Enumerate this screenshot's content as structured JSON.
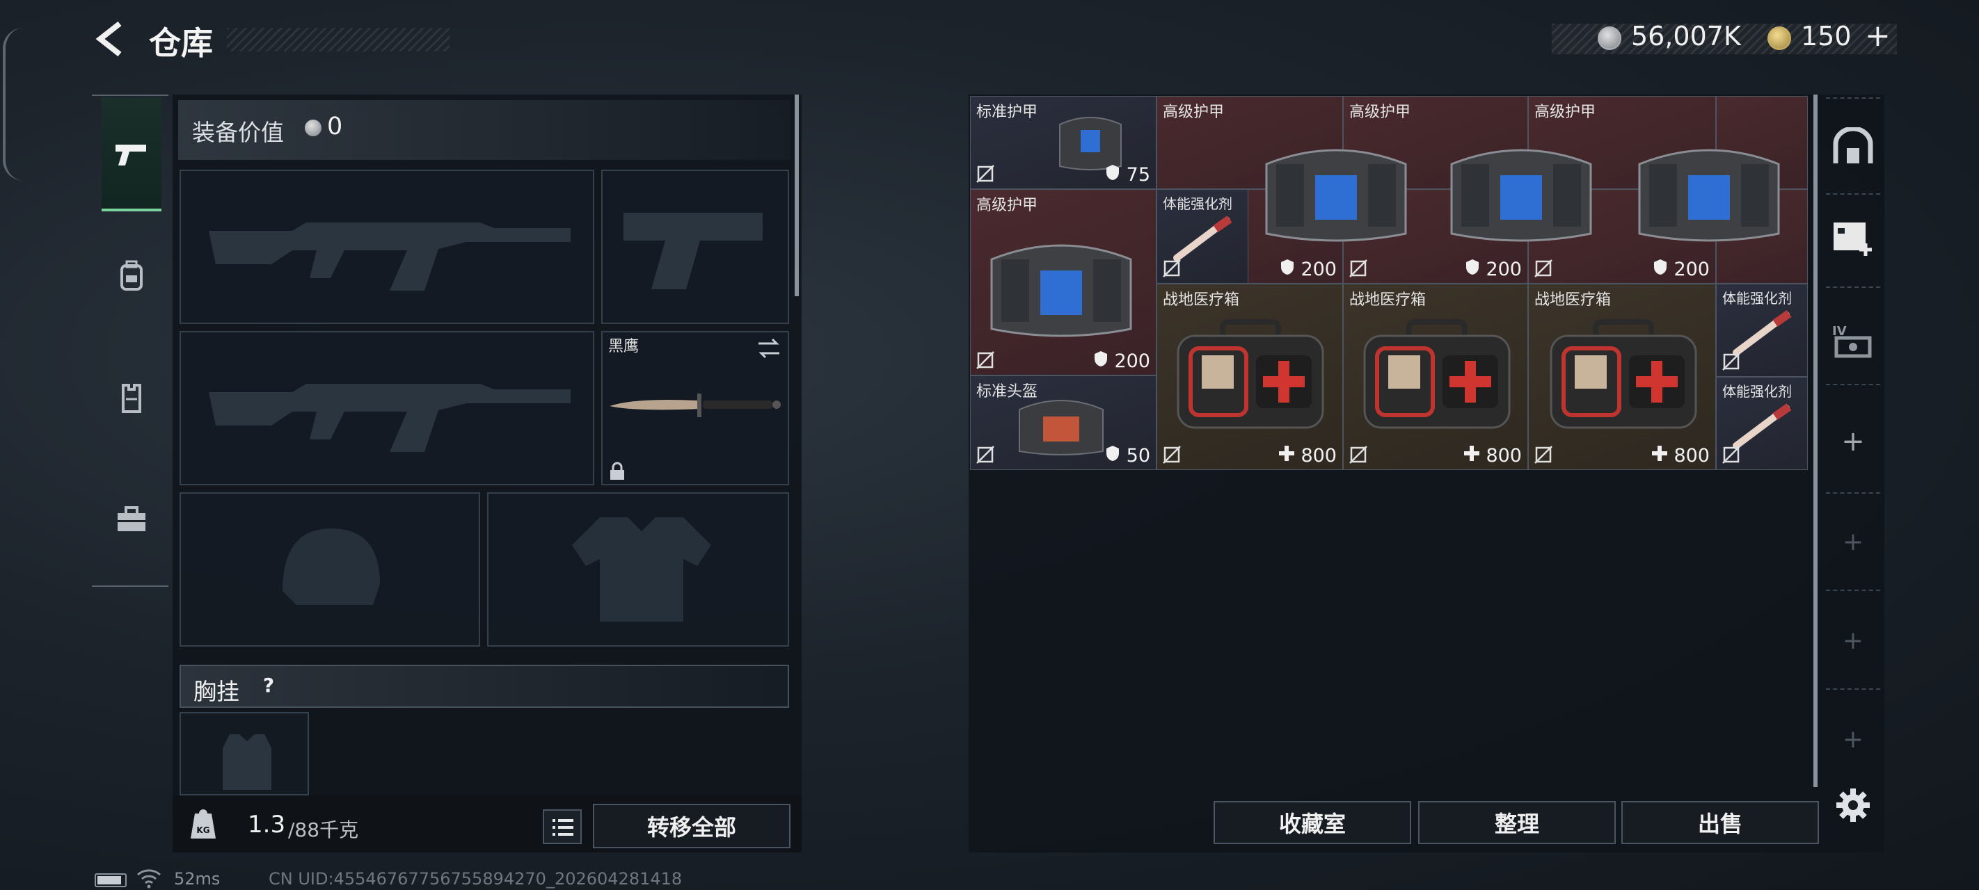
{
  "header": {
    "title": "仓库",
    "silver_amount": "56,007K",
    "gold_amount": "150"
  },
  "left": {
    "equip_value_label": "装备价值",
    "equip_value": "0",
    "melee": {
      "name": "黑鹰"
    },
    "chest_rig_label": "胸挂",
    "chest_rig_help": "?",
    "weight": {
      "current": "1.3",
      "max": "/88千克"
    },
    "transfer_all": "转移全部"
  },
  "grid": {
    "items": [
      {
        "name": "标准护甲",
        "value": "75",
        "value_icon": "shield-icon",
        "tint": "blue"
      },
      {
        "name": "高级护甲",
        "value": "",
        "tint": "red"
      },
      {
        "name": "高级护甲",
        "value": "",
        "tint": "red"
      },
      {
        "name": "高级护甲",
        "value": "",
        "tint": "red"
      },
      {
        "name": "高级护甲",
        "value": "200",
        "value_icon": "shield-icon",
        "tint": "red"
      },
      {
        "name": "体能强化剂",
        "value": "",
        "tint": "blue"
      },
      {
        "name": "",
        "value": "200",
        "value_icon": "shield-icon"
      },
      {
        "name": "",
        "value": "200",
        "value_icon": "shield-icon"
      },
      {
        "name": "",
        "value": "200",
        "value_icon": "shield-icon"
      },
      {
        "name": "战地医疗箱",
        "value": "800",
        "value_icon": "plus-icon",
        "tint": "tan"
      },
      {
        "name": "战地医疗箱",
        "value": "800",
        "value_icon": "plus-icon",
        "tint": "tan"
      },
      {
        "name": "战地医疗箱",
        "value": "800",
        "value_icon": "plus-icon",
        "tint": "tan"
      },
      {
        "name": "体能强化剂",
        "value": "",
        "tint": "blue"
      },
      {
        "name": "标准头盔",
        "value": "50",
        "value_icon": "shield-icon",
        "tint": "blue"
      },
      {
        "name": "体能强化剂",
        "value": "",
        "tint": "blue"
      }
    ]
  },
  "buttons": {
    "collection": "收藏室",
    "organize": "整理",
    "sell": "出售"
  },
  "status": {
    "ping": "52ms",
    "uid": "CN UID:45546767756755894270_202604281418"
  },
  "colors": {
    "red_item": "#4a2a2e",
    "tan_item": "#3c3429",
    "accent_green": "#7bd4a0"
  }
}
